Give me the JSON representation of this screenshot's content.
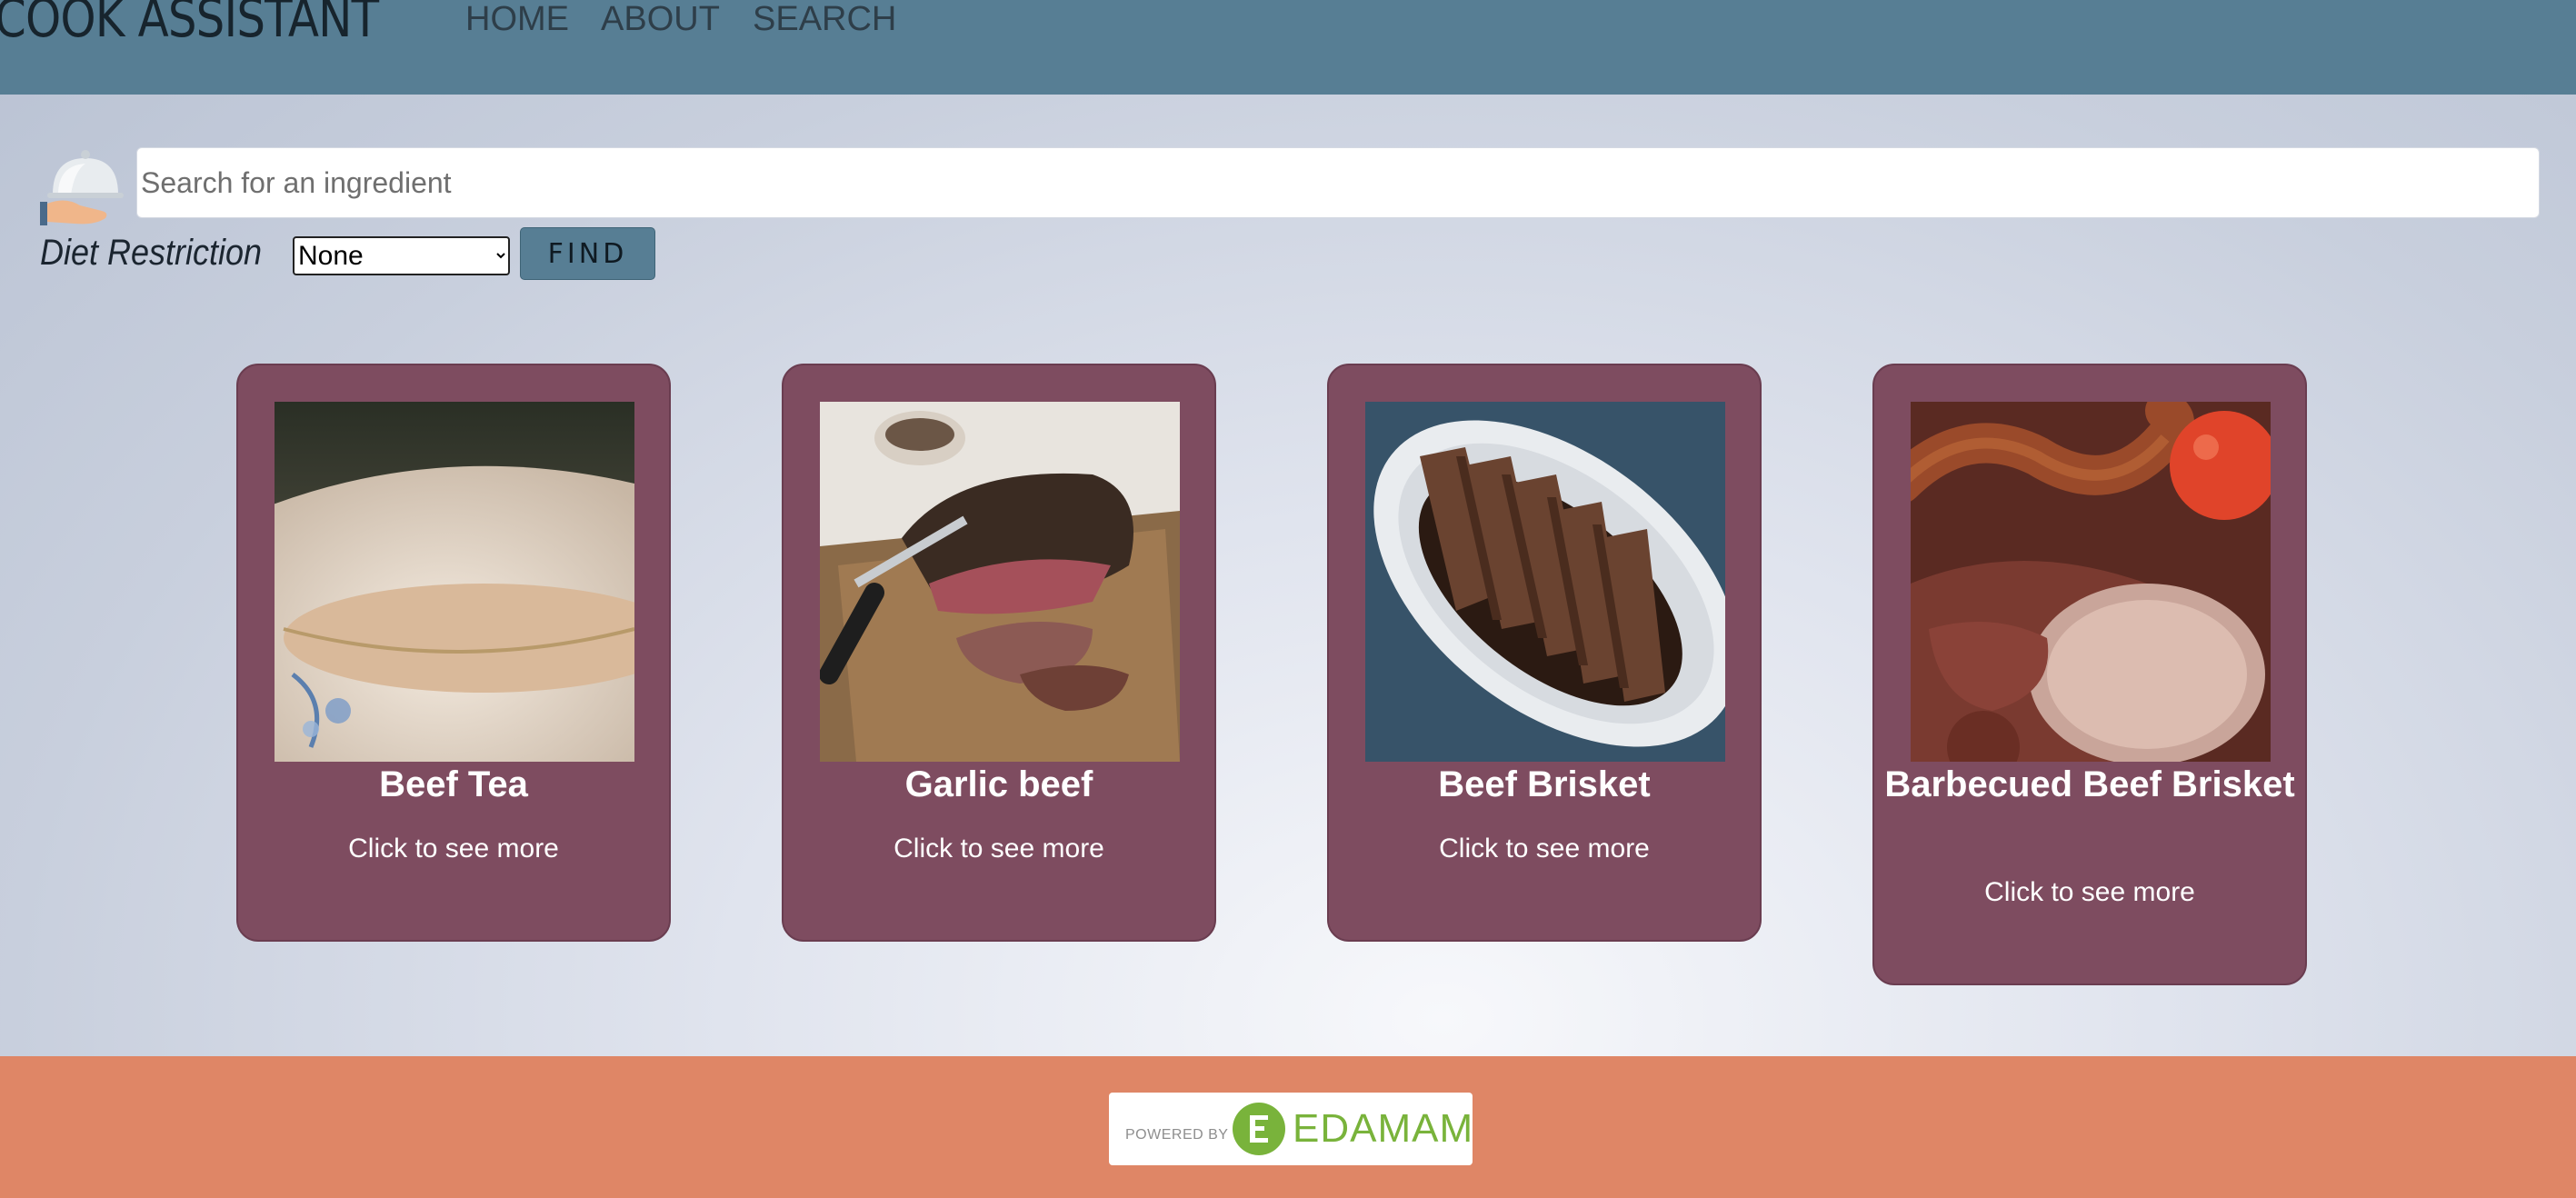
{
  "header": {
    "brand": "COOK ASSISTANT",
    "nav": [
      "HOME",
      "ABOUT",
      "SEARCH"
    ]
  },
  "search": {
    "placeholder": "Search for an ingredient",
    "value": "",
    "diet_label": "Diet Restriction",
    "diet_selected": "None",
    "find_label": "FIND"
  },
  "recipes": [
    {
      "title": "Beef Tea",
      "more": "Click to see more",
      "image": "cup-of-broth-photo"
    },
    {
      "title": "Garlic beef",
      "more": "Click to see more",
      "image": "sliced-roast-beef-photo"
    },
    {
      "title": "Beef Brisket",
      "more": "Click to see more",
      "image": "brisket-platter-photo"
    },
    {
      "title": "Barbecued Beef Brisket",
      "more": "Click to see more",
      "image": "bbq-meats-photo"
    }
  ],
  "footer": {
    "powered_by": "POWERED BY",
    "logo_text": "EDAMAM"
  },
  "colors": {
    "header": "#577e94",
    "card": "#7e4c60",
    "footer": "#df8666",
    "edamam_green": "#79b33b"
  }
}
